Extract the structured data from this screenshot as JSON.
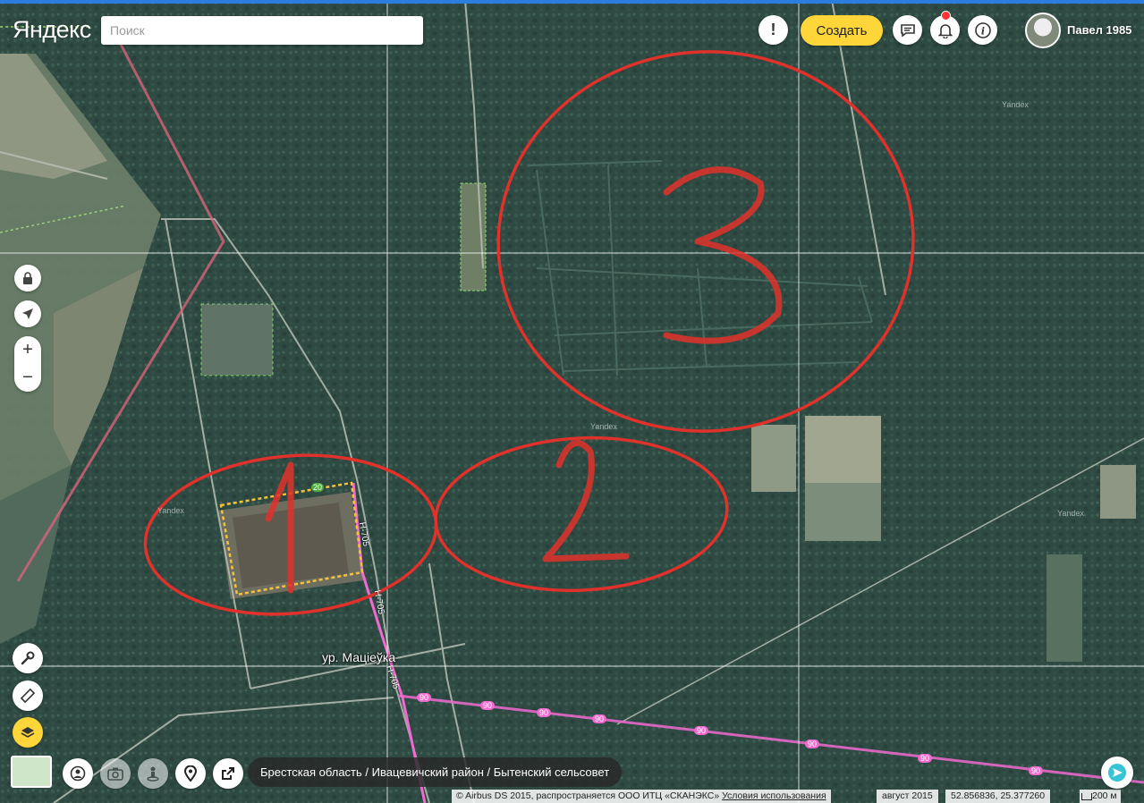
{
  "header": {
    "logo": "Яндекс",
    "search_placeholder": "Поиск",
    "create_label": "Создать",
    "user_name": "Павел 1985"
  },
  "map": {
    "place_label": "ур. Маціеўка",
    "road_labels": [
      "Н-705",
      "Н-705",
      "Н-705"
    ],
    "watermark": "Yandex",
    "breadcrumb": "Брестская область / Ивацевичский район / Бытенский сельсовет",
    "copyright": "© Airbus DS 2015, распространяется ООО ИТЦ «СКАНЭКС»",
    "terms_link": "Условия использования",
    "imagery_date": "август 2015",
    "coordinates": "52.856836, 25.377260",
    "scale": "200 м",
    "annotations": [
      "1",
      "2",
      "3"
    ],
    "route_shield": "90",
    "poi_badge": "20"
  },
  "icons": {
    "feedback": "exclamation-icon",
    "messages": "chat-icon",
    "notifications": "bell-icon",
    "info": "info-icon"
  },
  "colors": {
    "accent": "#ffd63a",
    "annotation": "#e0312a",
    "route": "#f06ad0",
    "top_bar": "#2b7de0"
  }
}
